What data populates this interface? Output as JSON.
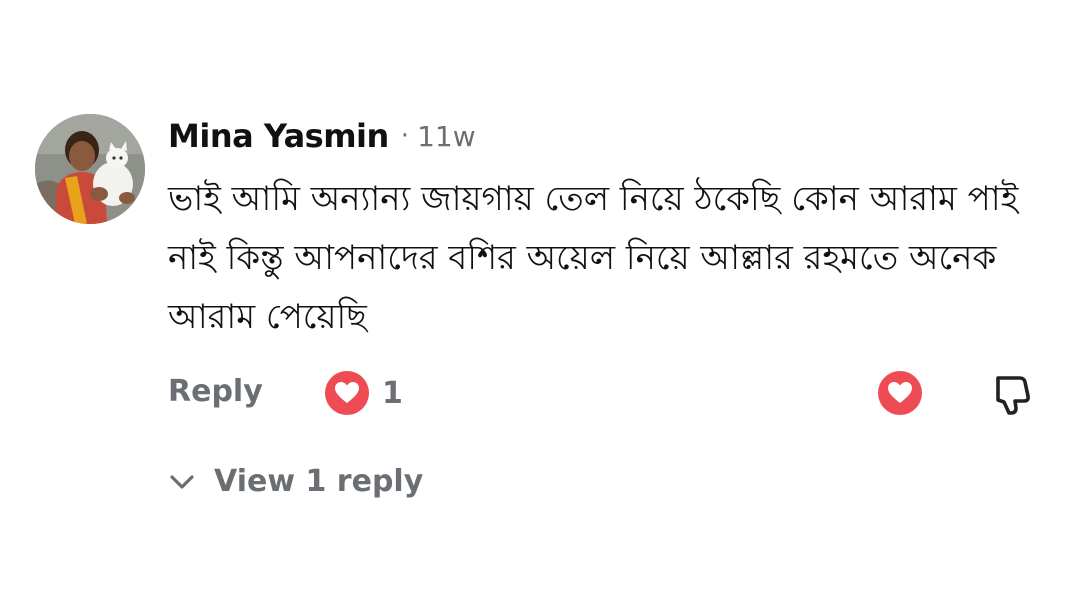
{
  "comment": {
    "author": "Mina Yasmin",
    "separator": "·",
    "age": "11w",
    "text": "ভাই আমি অন্যান্য জায়গায় তেল নিয়ে ঠকেছি কোন আরাম পাই নাই কিন্তু আপনাদের বশির অয়েল নিয়ে আল্লার রহমতে অনেক আরাম পেয়েছি",
    "avatar_icon": "profile-photo-woman-holding-cat"
  },
  "actions": {
    "reply_label": "Reply",
    "reaction_icon": "heart-reaction-icon",
    "reaction_count": "1",
    "love_icon": "heart-icon",
    "dislike_icon": "thumbs-down-icon"
  },
  "replies": {
    "toggle_icon": "chevron-down-icon",
    "label": "View 1 reply"
  },
  "colors": {
    "text": "#111111",
    "muted": "#6b6f74",
    "heart_red": "#ef4b55"
  }
}
